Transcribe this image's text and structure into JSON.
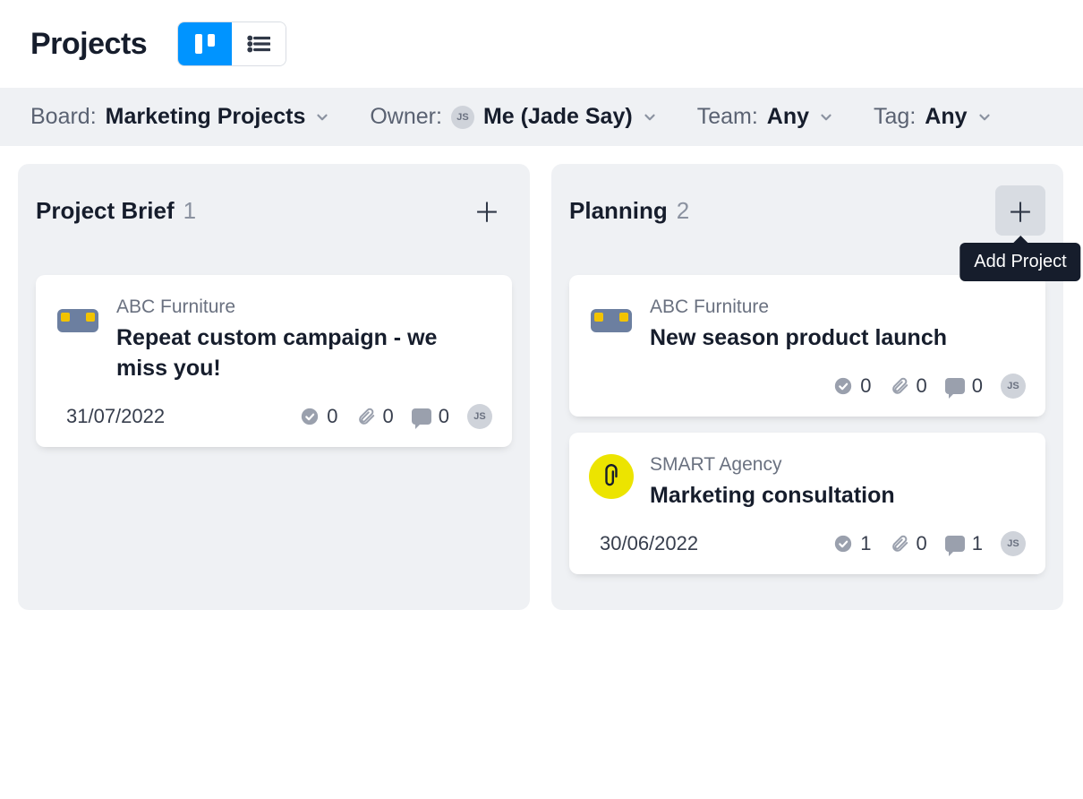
{
  "header": {
    "title": "Projects"
  },
  "filters": {
    "board_label": "Board:",
    "board_value": "Marketing Projects",
    "owner_label": "Owner:",
    "owner_value": "Me (Jade Say)",
    "owner_initials": "JS",
    "team_label": "Team:",
    "team_value": "Any",
    "tag_label": "Tag:",
    "tag_value": "Any"
  },
  "tooltip_add": "Add Project",
  "columns": [
    {
      "title": "Project Brief",
      "count": "1",
      "add_hovered": false,
      "cards": [
        {
          "client": "ABC Furniture",
          "logo": "sofa",
          "title": "Repeat custom campaign - we miss you!",
          "due": "31/07/2022",
          "checks": "0",
          "attachments": "0",
          "comments": "0",
          "assignee_initials": "JS"
        }
      ]
    },
    {
      "title": "Planning",
      "count": "2",
      "add_hovered": true,
      "cards": [
        {
          "client": "ABC Furniture",
          "logo": "sofa",
          "title": "New season product launch",
          "due": "",
          "checks": "0",
          "attachments": "0",
          "comments": "0",
          "assignee_initials": "JS"
        },
        {
          "client": "SMART Agency",
          "logo": "smart",
          "title": "Marketing consultation",
          "due": "30/06/2022",
          "checks": "1",
          "attachments": "0",
          "comments": "1",
          "assignee_initials": "JS"
        }
      ]
    }
  ]
}
